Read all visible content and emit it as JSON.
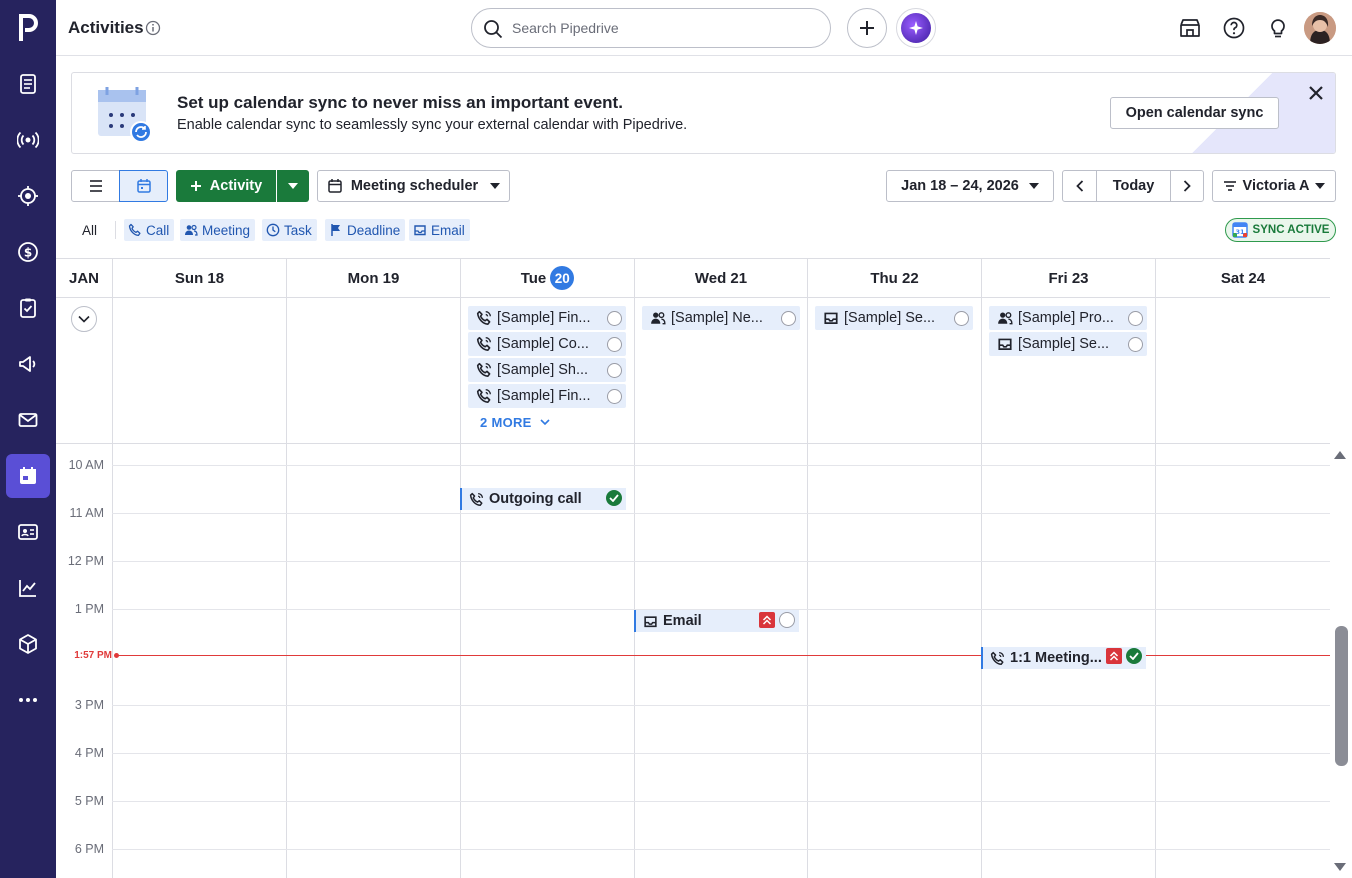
{
  "header": {
    "title": "Activities",
    "search_placeholder": "Search Pipedrive"
  },
  "banner": {
    "title": "Set up calendar sync to never miss an important event.",
    "description": "Enable calendar sync to seamlessly sync your external calendar with Pipedrive.",
    "button": "Open calendar sync"
  },
  "toolbar": {
    "activity_label": "Activity",
    "meeting_scheduler": "Meeting scheduler",
    "date_range": "Jan 18 – 24, 2026",
    "today": "Today",
    "user": "Victoria A"
  },
  "filters": {
    "all": "All",
    "types": [
      "Call",
      "Meeting",
      "Task",
      "Deadline",
      "Email"
    ],
    "sync_status": "SYNC ACTIVE"
  },
  "calendar": {
    "month": "JAN",
    "days": [
      {
        "label": "Sun 18"
      },
      {
        "label": "Mon 19"
      },
      {
        "label": "Tue",
        "number": "20",
        "is_today": true
      },
      {
        "label": "Wed 21"
      },
      {
        "label": "Thu 22"
      },
      {
        "label": "Fri 23"
      },
      {
        "label": "Sat 24"
      }
    ],
    "all_day": {
      "tue": [
        {
          "icon": "phone-icon",
          "title": "[Sample] Fin..."
        },
        {
          "icon": "phone-icon",
          "title": "[Sample] Co..."
        },
        {
          "icon": "phone-icon",
          "title": "[Sample] Sh..."
        },
        {
          "icon": "phone-icon",
          "title": "[Sample] Fin..."
        }
      ],
      "tue_more": "2 MORE",
      "wed": [
        {
          "icon": "meeting-icon",
          "title": "[Sample] Ne..."
        }
      ],
      "thu": [
        {
          "icon": "email-icon",
          "title": "[Sample] Se..."
        }
      ],
      "fri": [
        {
          "icon": "meeting-icon",
          "title": "[Sample] Pro..."
        },
        {
          "icon": "email-icon",
          "title": "[Sample] Se..."
        }
      ]
    },
    "hours": [
      "10 AM",
      "11 AM",
      "12 PM",
      "1 PM",
      "3 PM",
      "4 PM",
      "5 PM",
      "6 PM"
    ],
    "now_label": "1:57 PM",
    "timed_events": {
      "outgoing_call": "Outgoing call",
      "email": "Email",
      "meeting": "1:1 Meeting..."
    }
  },
  "colors": {
    "sidebar": "#26235e",
    "sidebar_active": "#5a4fd6",
    "primary_green": "#1a7a3b",
    "accent_blue": "#317ae2",
    "now_red": "#e03a3a",
    "priority_red": "#d9353b"
  }
}
